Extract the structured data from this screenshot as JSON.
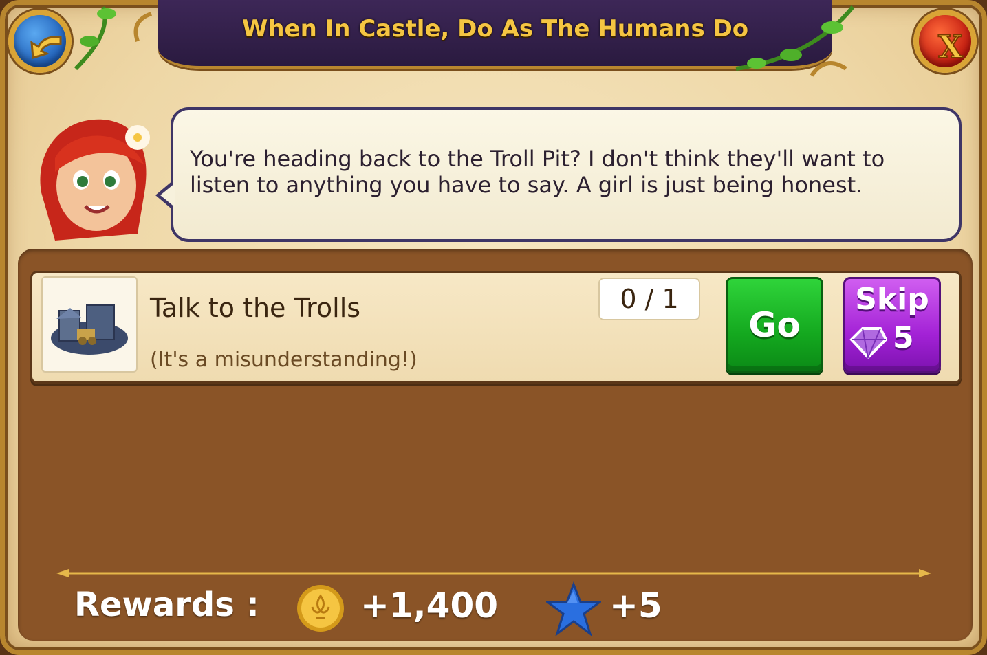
{
  "dialog": {
    "title": "When In Castle, Do As The Humans Do",
    "close_label": "X"
  },
  "speaker": {
    "avatar_icon": "red-haired-girl-portrait",
    "message_line1": "You're heading back to the Troll Pit? I don't think they'll want to",
    "message_line2": "listen to anything you have to say. A girl is just being honest."
  },
  "task": {
    "icon": "troll-pit-building-icon",
    "title": "Talk to the Trolls",
    "subtitle": "(It's a misunderstanding!)",
    "progress": "0 / 1",
    "go_label": "Go",
    "skip_label": "Skip",
    "skip_cost": "5"
  },
  "rewards": {
    "label": "Rewards :",
    "items": [
      {
        "icon": "gold-coin-icon",
        "value": "+1,400"
      },
      {
        "icon": "blue-star-icon",
        "value": "+5"
      }
    ]
  },
  "colors": {
    "title_gold": "#f5c542",
    "panel_brown": "#8a5427",
    "go_green": "#14a81f",
    "skip_purple": "#a322d6"
  }
}
